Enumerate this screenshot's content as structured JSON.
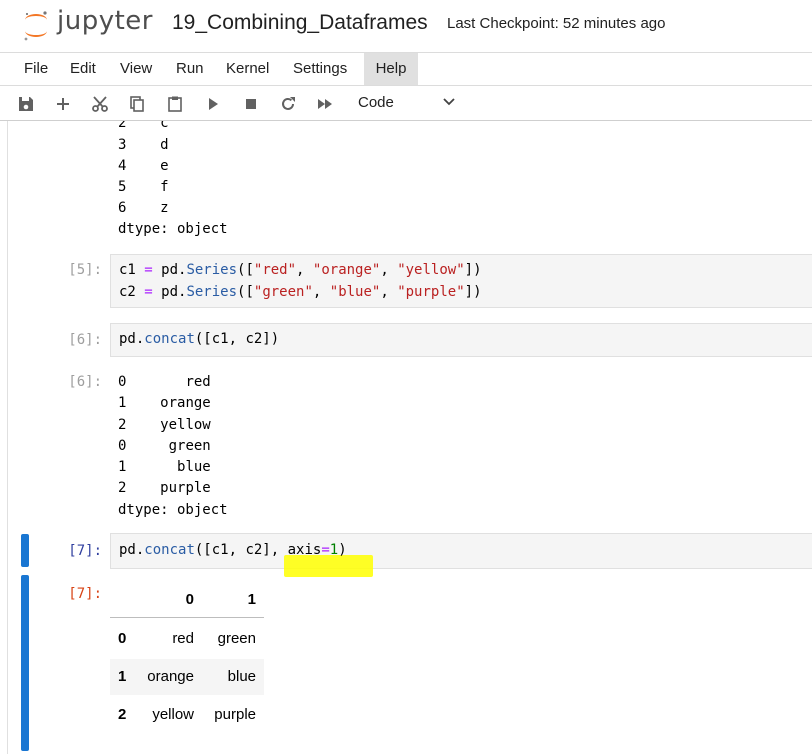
{
  "header": {
    "logo_text": "jupyter",
    "notebook_title": "19_Combining_Dataframes",
    "checkpoint": "Last Checkpoint: 52 minutes ago"
  },
  "menu": [
    "File",
    "Edit",
    "View",
    "Run",
    "Kernel",
    "Settings",
    "Help"
  ],
  "toolbar": {
    "buttons": [
      "save-icon",
      "add-cell-icon",
      "cut-icon",
      "copy-icon",
      "paste-icon",
      "run-icon",
      "stop-icon",
      "restart-icon",
      "fast-forward-icon"
    ],
    "cell_type": "Code"
  },
  "cells": {
    "top_output": {
      "rows": [
        {
          "idx": "2",
          "val": "c"
        },
        {
          "idx": "3",
          "val": "d"
        },
        {
          "idx": "4",
          "val": "e"
        },
        {
          "idx": "5",
          "val": "f"
        },
        {
          "idx": "6",
          "val": "z"
        }
      ],
      "dtype": "dtype: object"
    },
    "cell5": {
      "prompt": "[5]:",
      "lines": [
        "c1 = pd.Series([\"red\", \"orange\", \"yellow\"])",
        "c2 = pd.Series([\"green\", \"blue\", \"purple\"])"
      ]
    },
    "cell6": {
      "prompt": "[6]:",
      "code": "pd.concat([c1, c2])",
      "out_prompt": "[6]:",
      "output": [
        {
          "idx": "0",
          "val": "red"
        },
        {
          "idx": "1",
          "val": "orange"
        },
        {
          "idx": "2",
          "val": "yellow"
        },
        {
          "idx": "0",
          "val": "green"
        },
        {
          "idx": "1",
          "val": "blue"
        },
        {
          "idx": "2",
          "val": "purple"
        }
      ],
      "dtype": "dtype: object"
    },
    "cell7": {
      "prompt": "[7]:",
      "code": "pd.concat([c1, c2], axis=1)",
      "out_prompt": "[7]:",
      "dataframe": {
        "columns": [
          "0",
          "1"
        ],
        "rows": [
          {
            "index": "0",
            "c0": "red",
            "c1": "green"
          },
          {
            "index": "1",
            "c0": "orange",
            "c1": "blue"
          },
          {
            "index": "2",
            "c0": "yellow",
            "c1": "purple"
          }
        ]
      }
    }
  },
  "colors": {
    "active_bar": "#1976d2",
    "highlight": "#ffff00",
    "jupyter_orange": "#f37726"
  }
}
